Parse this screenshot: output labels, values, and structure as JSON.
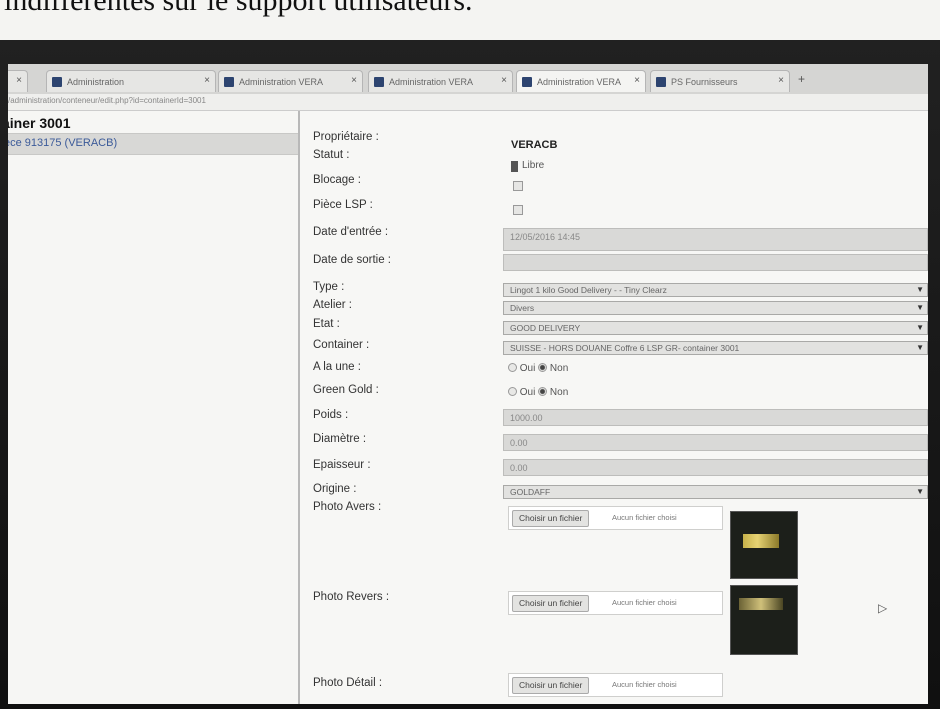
{
  "caption": "indifférentes sur le support utilisateurs.",
  "browser": {
    "tabs": [
      {
        "label": "Administration"
      },
      {
        "label": "Administration VERA"
      },
      {
        "label": "Administration VERA"
      },
      {
        "label": "Administration VERA"
      },
      {
        "label": "PS Fournisseurs"
      }
    ],
    "url": "/administration/conteneur/edit.php?id=containerId=3001"
  },
  "left_panel": {
    "title": "ainer 3001",
    "item": "ece 913175 (VERACB)"
  },
  "form": {
    "labels": {
      "proprietaire": "Propriétaire :",
      "statut": "Statut :",
      "blocage": "Blocage :",
      "piece_lsp": "Pièce LSP :",
      "date_entree": "Date d'entrée :",
      "date_sortie": "Date de sortie :",
      "type": "Type :",
      "atelier": "Atelier :",
      "etat": "Etat :",
      "container": "Container :",
      "a_la_une": "A la une :",
      "green_gold": "Green Gold :",
      "poids": "Poids :",
      "diametre": "Diamètre :",
      "epaisseur": "Epaisseur :",
      "origine": "Origine :",
      "photo_avers": "Photo Avers :",
      "photo_revers": "Photo Revers :",
      "photo_detail": "Photo Détail :"
    },
    "values": {
      "proprietaire": "VERACB",
      "statut": "Libre",
      "date_entree": "12/05/2016 14:45",
      "date_sortie": "",
      "type": "Lingot 1 kilo Good Delivery - - Tiny Clearz",
      "atelier": "Divers",
      "etat": "GOOD DELIVERY",
      "container": "SUISSE - HORS DOUANE Coffre 6 LSP GR- container 3001",
      "poids": "1000.00",
      "diametre": "0.00",
      "epaisseur": "0.00",
      "origine": "GOLDAFF"
    },
    "radio": {
      "oui": "Oui",
      "non": "Non",
      "a_la_une_selected": "Non",
      "green_gold_selected": "Non"
    },
    "file": {
      "button": "Choisir un fichier",
      "status": "Aucun fichier choisi"
    }
  },
  "icons": {
    "tab_close": "×",
    "new_tab": "+",
    "dropdown": "▼",
    "cursor": "▷"
  }
}
